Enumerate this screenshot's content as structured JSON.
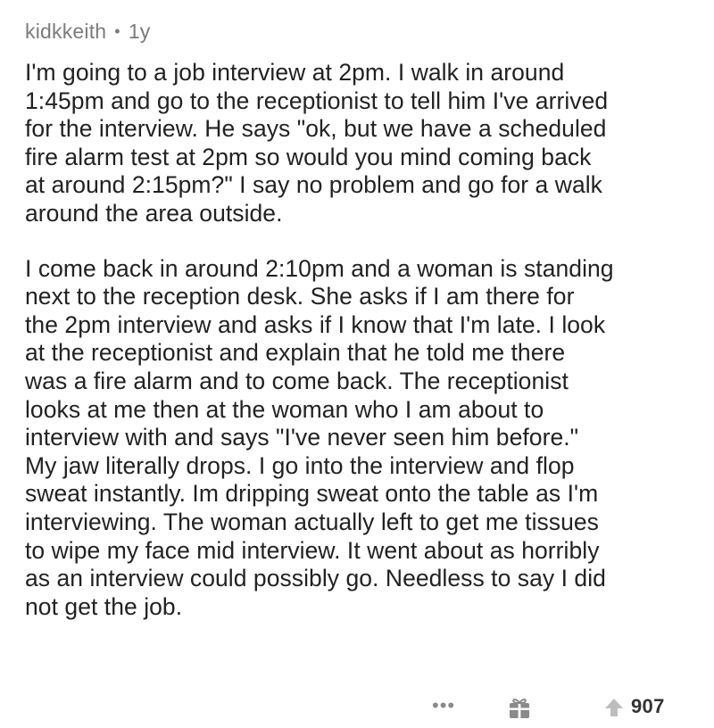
{
  "comment": {
    "author": "kidkkeith",
    "separator": "•",
    "age": "1y",
    "paragraphs": [
      [
        "I'm going to a job interview at 2pm. I walk in around",
        "1:45pm and go to the receptionist to tell him I've arrived",
        "for the interview. He says \"ok, but we have a scheduled",
        "fire alarm test at 2pm so would you mind coming back",
        "at around 2:15pm?\" I say no problem and go for a walk",
        "around the area outside."
      ],
      [
        "I come back in around 2:10pm and a woman is standing",
        "next to the reception desk. She asks if I am there for",
        "the 2pm interview and asks if I know that I'm late. I look",
        "at the receptionist and explain that he told me there",
        "was a fire alarm and to come back. The receptionist",
        "looks at me then at the woman who I am about to",
        "interview with and says \"I've never seen him before.\"",
        "My jaw literally drops. I go into the interview and flop",
        "sweat instantly. Im dripping sweat onto the table as I'm",
        "interviewing. The woman actually left to get me tissues",
        "to wipe my face mid interview. It went about as horribly",
        "as an interview could possibly go. Needless to say I did",
        "not get the job."
      ]
    ],
    "actions": {
      "more_label": "•••",
      "gift_icon": "gift-icon",
      "upvote_icon": "upvote-arrow-icon",
      "score": "907"
    }
  }
}
